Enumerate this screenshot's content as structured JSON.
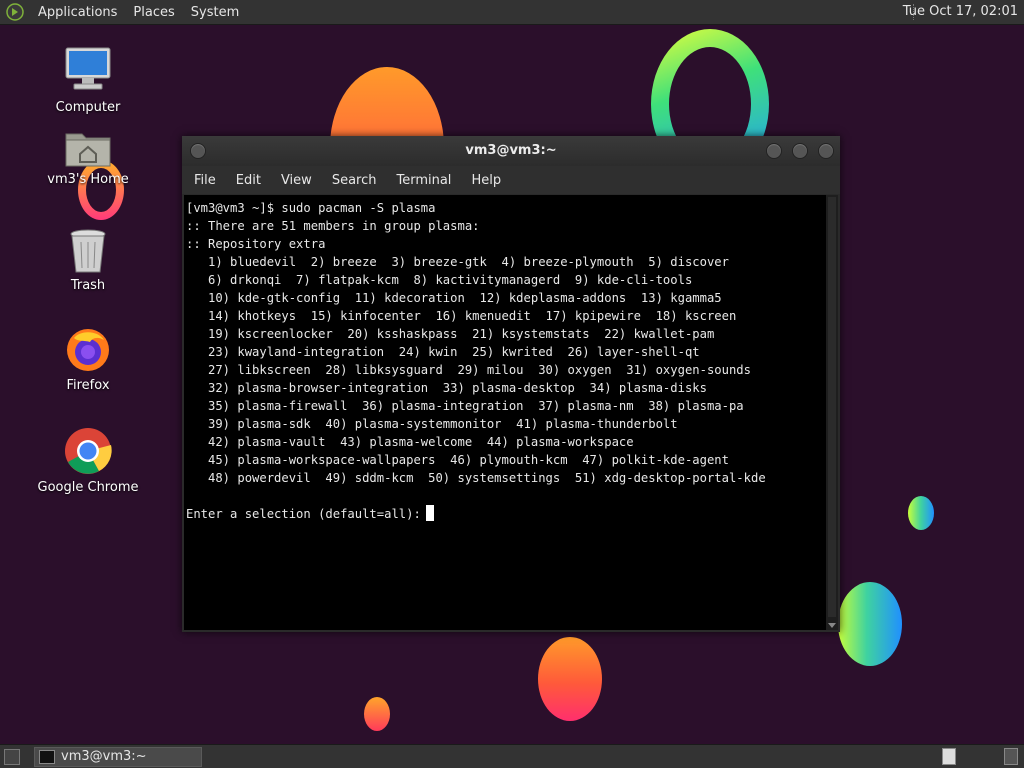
{
  "top_panel": {
    "menus": [
      "Applications",
      "Places",
      "System"
    ],
    "clock": "Tue Oct 17, 02:01"
  },
  "desktop_icons": [
    {
      "label": "Computer",
      "icon": "computer-icon"
    },
    {
      "label": "vm3's Home",
      "icon": "home-folder-icon"
    },
    {
      "label": "Trash",
      "icon": "trash-icon"
    },
    {
      "label": "Firefox",
      "icon": "firefox-icon"
    },
    {
      "label": "Google Chrome",
      "icon": "chrome-icon"
    }
  ],
  "terminal": {
    "title": "vm3@vm3:~",
    "menu": [
      "File",
      "Edit",
      "View",
      "Search",
      "Terminal",
      "Help"
    ],
    "lines": [
      "[vm3@vm3 ~]$ sudo pacman -S plasma",
      ":: There are 51 members in group plasma:",
      ":: Repository extra",
      "   1) bluedevil  2) breeze  3) breeze-gtk  4) breeze-plymouth  5) discover",
      "   6) drkonqi  7) flatpak-kcm  8) kactivitymanagerd  9) kde-cli-tools",
      "   10) kde-gtk-config  11) kdecoration  12) kdeplasma-addons  13) kgamma5",
      "   14) khotkeys  15) kinfocenter  16) kmenuedit  17) kpipewire  18) kscreen",
      "   19) kscreenlocker  20) ksshaskpass  21) ksystemstats  22) kwallet-pam",
      "   23) kwayland-integration  24) kwin  25) kwrited  26) layer-shell-qt",
      "   27) libkscreen  28) libksysguard  29) milou  30) oxygen  31) oxygen-sounds",
      "   32) plasma-browser-integration  33) plasma-desktop  34) plasma-disks",
      "   35) plasma-firewall  36) plasma-integration  37) plasma-nm  38) plasma-pa",
      "   39) plasma-sdk  40) plasma-systemmonitor  41) plasma-thunderbolt",
      "   42) plasma-vault  43) plasma-welcome  44) plasma-workspace",
      "   45) plasma-workspace-wallpapers  46) plymouth-kcm  47) polkit-kde-agent",
      "   48) powerdevil  49) sddm-kcm  50) systemsettings  51) xdg-desktop-portal-kde",
      ""
    ],
    "prompt": "Enter a selection (default=all):"
  },
  "taskbar": {
    "window_label": "vm3@vm3:~"
  },
  "colors": {
    "wallpaper": "#2b0f2b",
    "panel": "#333333",
    "terminal_bg": "#000000",
    "terminal_fg": "#e8e8e8"
  }
}
